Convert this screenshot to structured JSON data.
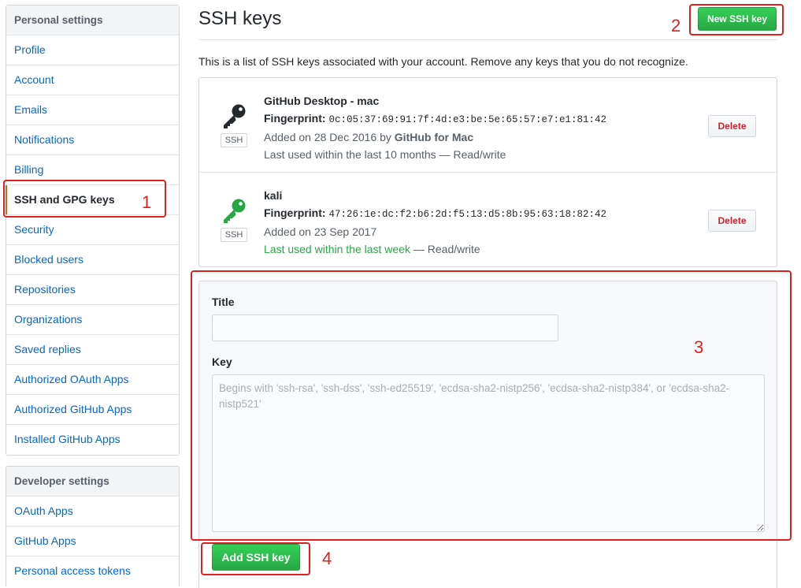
{
  "sidebar": {
    "personal_heading": "Personal settings",
    "personal_items": [
      {
        "label": "Profile"
      },
      {
        "label": "Account"
      },
      {
        "label": "Emails"
      },
      {
        "label": "Notifications"
      },
      {
        "label": "Billing"
      },
      {
        "label": "SSH and GPG keys"
      },
      {
        "label": "Security"
      },
      {
        "label": "Blocked users"
      },
      {
        "label": "Repositories"
      },
      {
        "label": "Organizations"
      },
      {
        "label": "Saved replies"
      },
      {
        "label": "Authorized OAuth Apps"
      },
      {
        "label": "Authorized GitHub Apps"
      },
      {
        "label": "Installed GitHub Apps"
      }
    ],
    "selected_item": "SSH and GPG keys",
    "developer_heading": "Developer settings",
    "developer_items": [
      {
        "label": "OAuth Apps"
      },
      {
        "label": "GitHub Apps"
      },
      {
        "label": "Personal access tokens"
      }
    ]
  },
  "main": {
    "title": "SSH keys",
    "new_key_button": "New SSH key",
    "intro": "This is a list of SSH keys associated with your account. Remove any keys that you do not recognize.",
    "keys": [
      {
        "icon": "key-icon",
        "icon_color": "#24292e",
        "type_label": "SSH",
        "title": "GitHub Desktop - mac",
        "fingerprint_label": "Fingerprint:",
        "fingerprint": "0c:05:37:69:91:7f:4d:e3:be:5e:65:57:e7:e1:81:42",
        "added_prefix": "Added on 28 Dec 2016 by",
        "added_by": "GitHub for Mac",
        "last_used": "Last used within the last 10 months",
        "access": " — Read/write",
        "delete_label": "Delete"
      },
      {
        "icon": "key-icon",
        "icon_color": "#28a745",
        "type_label": "SSH",
        "title": "kali",
        "fingerprint_label": "Fingerprint:",
        "fingerprint": "47:26:1e:dc:f2:b6:2d:f5:13:d5:8b:95:63:18:82:42",
        "added_prefix": "Added on 23 Sep 2017",
        "last_used": "Last used within the last week",
        "access": " — Read/write",
        "delete_label": "Delete"
      }
    ],
    "form": {
      "title_label": "Title",
      "title_value": "",
      "key_label": "Key",
      "key_placeholder": "Begins with 'ssh-rsa', 'ssh-dss', 'ssh-ed25519', 'ecdsa-sha2-nistp256', 'ecdsa-sha2-nistp384', or 'ecdsa-sha2-nistp521'",
      "submit_label": "Add SSH key"
    }
  },
  "annotations": {
    "color": "#e0201e",
    "numbers": [
      "1",
      "2",
      "3",
      "4"
    ]
  },
  "colors": {
    "link": "#0366d6",
    "primary_green": "#28a745",
    "danger": "#cb2431",
    "selected_marker": "#e36209"
  }
}
